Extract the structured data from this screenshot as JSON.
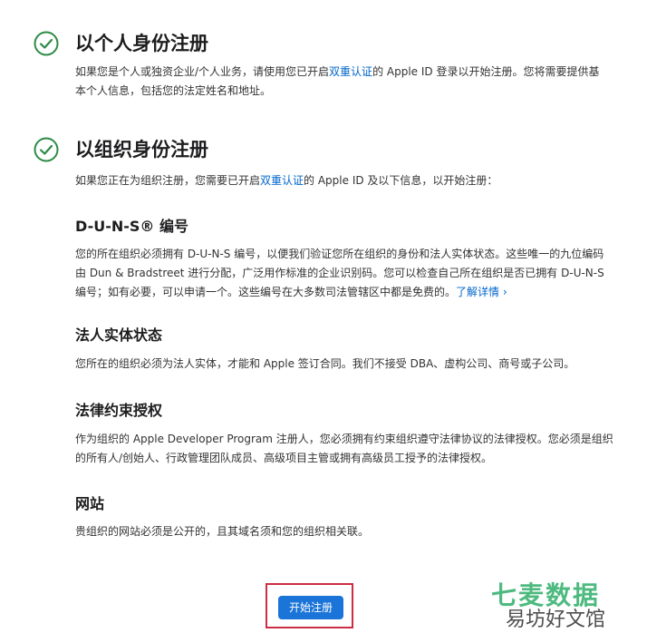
{
  "individual": {
    "title": "以个人身份注册",
    "desc_before": "如果您是个人或独资企业/个人业务，请使用您已开启",
    "desc_link": "双重认证",
    "desc_after": "的 Apple ID 登录以开始注册。您将需要提供基本个人信息，包括您的法定姓名和地址。"
  },
  "organization": {
    "title": "以组织身份注册",
    "desc_before": "如果您正在为组织注册，您需要已开启",
    "desc_link": "双重认证",
    "desc_after": "的 Apple ID 及以下信息，以开始注册："
  },
  "duns": {
    "title": "D-U-N-S® 编号",
    "desc": "您的所在组织必须拥有 D-U-N-S 编号，以便我们验证您所在组织的身份和法人实体状态。这些唯一的九位编码由 Dun & Bradstreet 进行分配，广泛用作标准的企业识别码。您可以检查自己所在组织是否已拥有 D-U-N-S 编号；如有必要，可以申请一个。这些编号在大多数司法管辖区中都是免费的。",
    "link": "了解详情 ›"
  },
  "legal_entity": {
    "title": "法人实体状态",
    "desc": "您所在的组织必须为法人实体，才能和 Apple 签订合同。我们不接受 DBA、虚构公司、商号或子公司。"
  },
  "legal_authority": {
    "title": "法律约束授权",
    "desc": "作为组织的 Apple Developer Program 注册人，您必须拥有约束组织遵守法律协议的法律授权。您必须是组织的所有人/创始人、行政管理团队成员、高级项目主管或拥有高级员工授予的法律授权。"
  },
  "website": {
    "title": "网站",
    "desc": "贵组织的网站必须是公开的，且其域名须和您的组织相关联。"
  },
  "cta": {
    "label": "开始注册"
  },
  "watermark": {
    "top": "七麦数据",
    "bottom": "易坊好文馆"
  },
  "colors": {
    "check_green": "#2d8a45",
    "link_blue": "#0066cc",
    "button_blue": "#1b74d8",
    "highlight_red": "#cc2c44",
    "watermark_green": "#2fae6a"
  },
  "icons": [
    "check-circle-icon"
  ]
}
